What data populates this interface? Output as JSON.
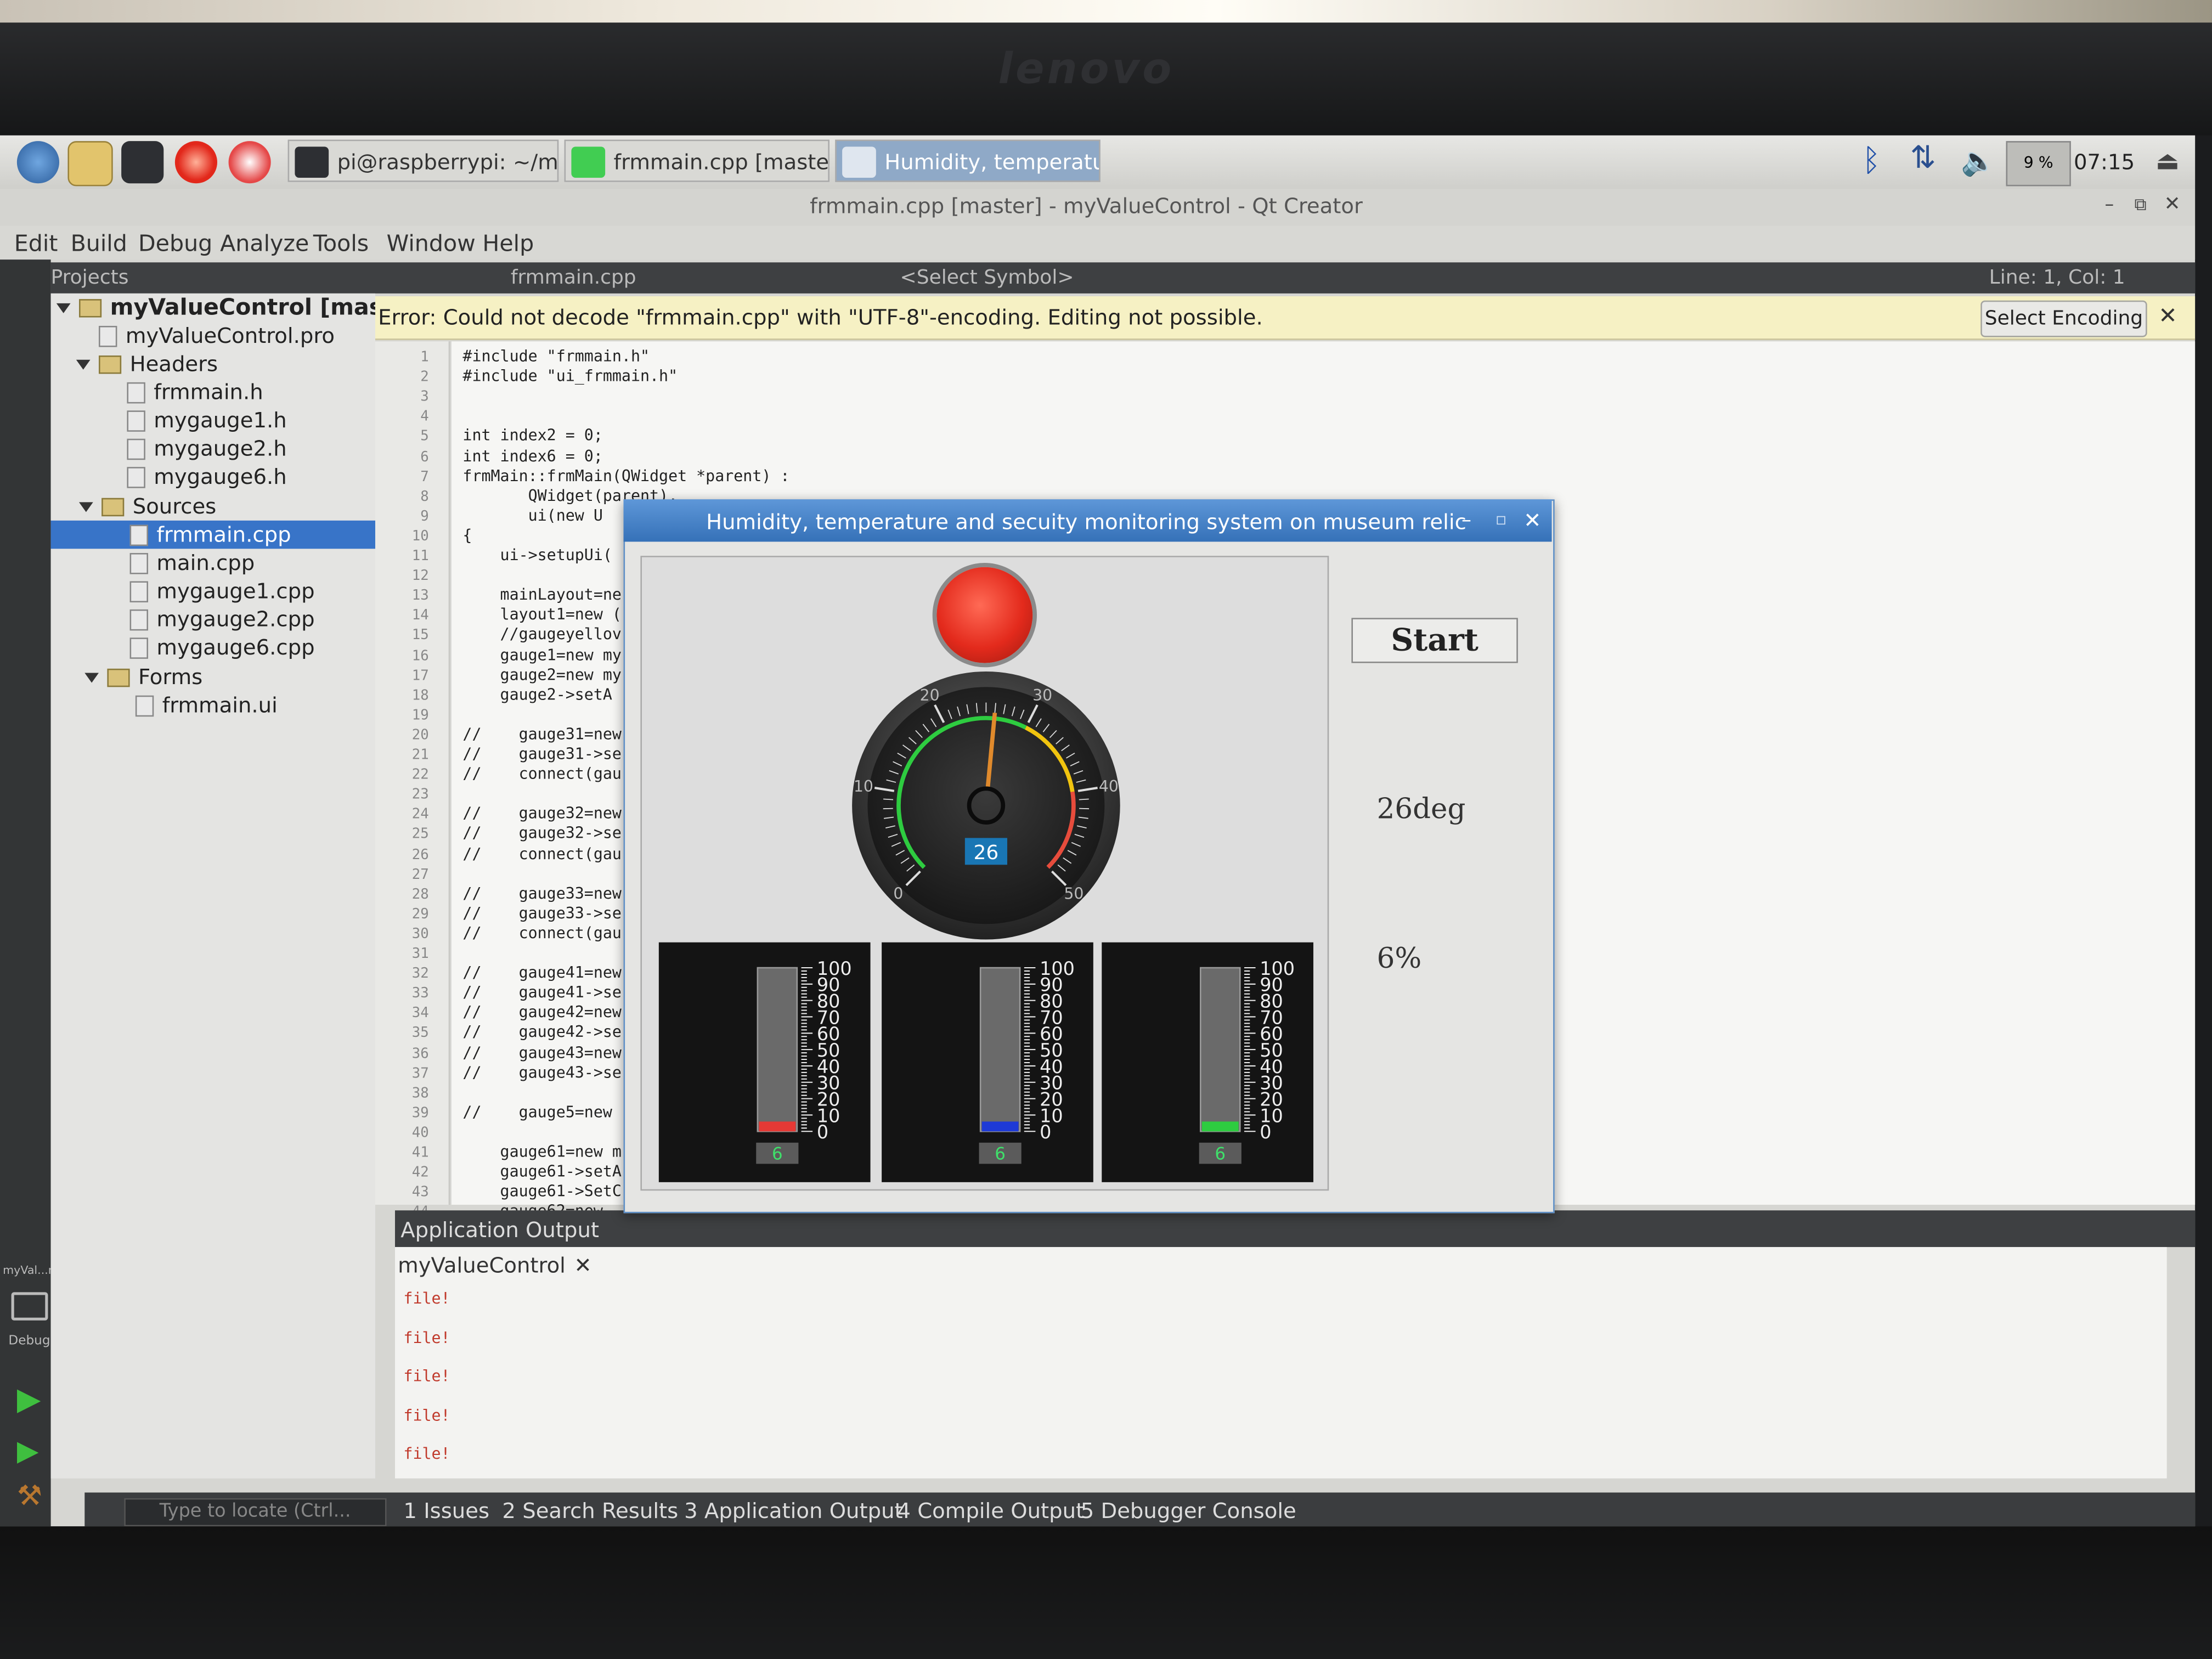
{
  "brand": "lenovo",
  "taskbar": {
    "tasks": [
      {
        "label": "pi@raspberrypi: ~/my..."
      },
      {
        "label": "frmmain.cpp [master]..."
      },
      {
        "label": "Humidity, temperatur..."
      }
    ],
    "cpu": "9 %",
    "clock": "07:15"
  },
  "window_title": "frmmain.cpp [master] - myValueControl - Qt Creator",
  "menu": [
    "Edit",
    "Build",
    "Debug",
    "Analyze",
    "Tools",
    "Window",
    "Help"
  ],
  "projects": {
    "header": "Projects",
    "root": "myValueControl [master]",
    "items": [
      "myValueControl.pro",
      "Headers",
      "frmmain.h",
      "mygauge1.h",
      "mygauge2.h",
      "mygauge6.h",
      "Sources",
      "frmmain.cpp",
      "main.cpp",
      "mygauge1.cpp",
      "mygauge2.cpp",
      "mygauge6.cpp",
      "Forms",
      "frmmain.ui"
    ],
    "locate_placeholder": "Type to locate (Ctrl..."
  },
  "editor": {
    "file": "frmmain.cpp",
    "symbol": "<Select Symbol>",
    "position": "Line: 1, Col: 1",
    "error": "Error: Could not decode \"frmmain.cpp\" with \"UTF-8\"-encoding. Editing not possible.",
    "select_encoding": "Select Encoding",
    "lines": [
      "#include \"frmmain.h\"",
      "#include \"ui_frmmain.h\"",
      "",
      "",
      "int index2 = 0;",
      "int index6 = 0;",
      "frmMain::frmMain(QWidget *parent) :",
      "       QWidget(parent),",
      "       ui(new U",
      "{",
      "    ui->setupUi(",
      "",
      "    mainLayout=ne",
      "    layout1=new (",
      "    //gaugeyellov",
      "    gauge1=new my",
      "    gauge2=new my",
      "    gauge2->setA",
      "",
      "//    gauge31=new",
      "//    gauge31->se",
      "//    connect(gau",
      "",
      "//    gauge32=new",
      "//    gauge32->se",
      "//    connect(gau",
      "",
      "//    gauge33=new",
      "//    gauge33->se",
      "//    connect(gau",
      "",
      "//    gauge41=new",
      "//    gauge41->se",
      "//    gauge42=new",
      "//    gauge42->se",
      "//    gauge43=new",
      "//    gauge43->se",
      "",
      "//    gauge5=new",
      "",
      "    gauge61=new m",
      "    gauge61->setA",
      "    gauge61->SetC",
      "    gauge62=new"
    ]
  },
  "output": {
    "title": "Application Output",
    "tab": "myValueControl",
    "lines": [
      "file!",
      "file!",
      "file!",
      "file!",
      "file!"
    ]
  },
  "status_tabs": [
    "1 Issues",
    "2 Search Results",
    "3 Application Output",
    "4 Compile Output",
    "5 Debugger Console"
  ],
  "dock": {
    "project_label": "myVal...ntrol",
    "debug_label": "Debug"
  },
  "dialog": {
    "title": "Humidity, temperature and secuity monitoring system on museum relic",
    "start_label": "Start",
    "temperature_text": "26deg",
    "humidity_text": "6%",
    "gauge": {
      "value": 26,
      "value_label": "26",
      "min": 0,
      "max": 50,
      "ticks": [
        "0",
        "10",
        "20",
        "30",
        "40",
        "50"
      ]
    },
    "thermometers": [
      {
        "value": 6,
        "value_label": "6",
        "color": "#e53935"
      },
      {
        "value": 6,
        "value_label": "6",
        "color": "#1e3ad6"
      },
      {
        "value": 6,
        "value_label": "6",
        "color": "#2ecc40"
      }
    ],
    "therm_scale": [
      "100",
      "90",
      "80",
      "70",
      "60",
      "50",
      "40",
      "30",
      "20",
      "10",
      "0"
    ]
  }
}
